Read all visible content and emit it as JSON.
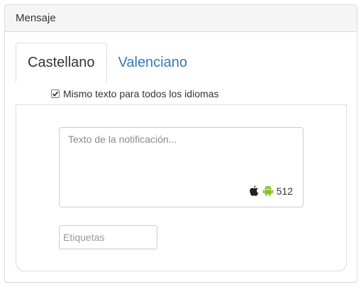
{
  "panel": {
    "title": "Mensaje"
  },
  "tabs": [
    {
      "label": "Castellano",
      "active": true
    },
    {
      "label": "Valenciano",
      "active": false
    }
  ],
  "same_text_checkbox": {
    "label": "Mismo texto para todos los idiomas",
    "checked": true
  },
  "message": {
    "placeholder": "Texto de la notificación...",
    "value": "",
    "remaining": "512",
    "platform_icons": [
      "apple-icon",
      "android-icon"
    ]
  },
  "tags": {
    "placeholder": "Etiquetas"
  },
  "colors": {
    "link": "#337ab7",
    "android": "#8bbf2f",
    "apple": "#222222"
  }
}
